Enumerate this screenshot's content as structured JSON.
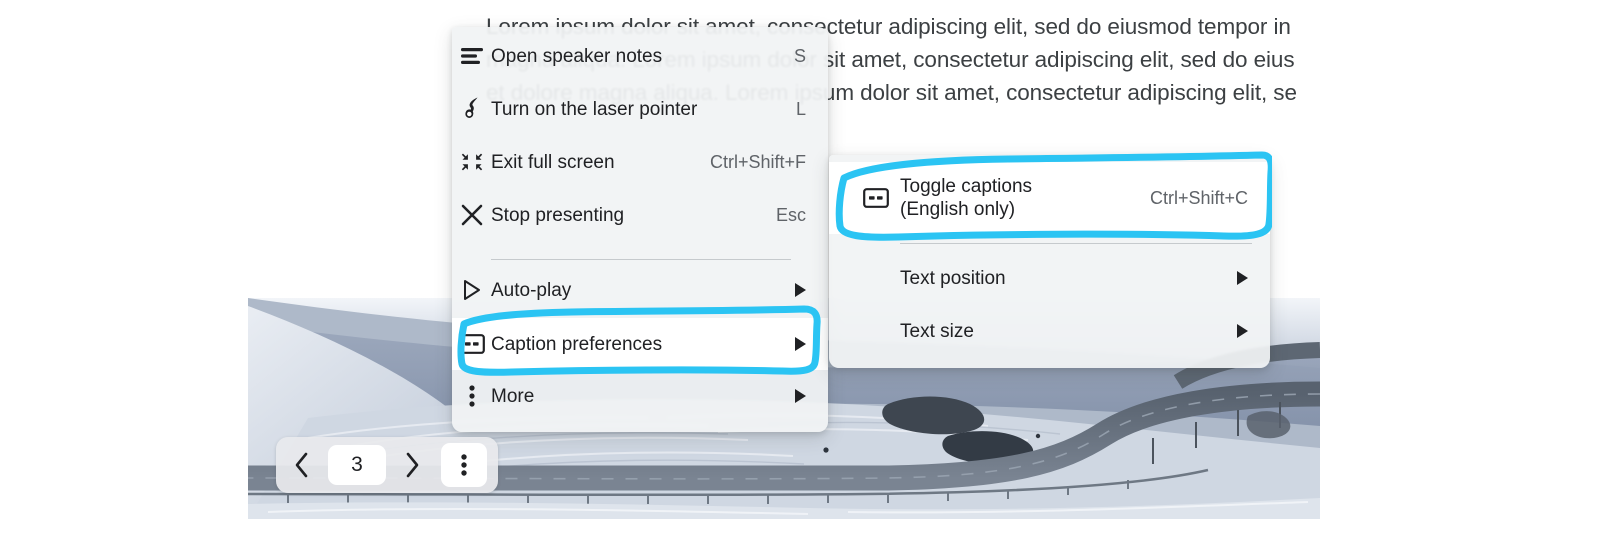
{
  "slide": {
    "lines": [
      "Lorem ipsum dolor sit amet, consectetur adipiscing elit, sed do eiusmod tempor in",
      "magna aliqua. Lorem ipsum dolor sit amet, consectetur adipiscing elit, sed do eius",
      "et dolore magna aliqua. Lorem ipsum dolor sit amet, consectetur adipiscing elit, se"
    ]
  },
  "colors": {
    "accent_cyan": "#2BC4F3",
    "menu_bg": "#F1F3F4",
    "highlight_bg": "#FFFFFF",
    "text": "#202124",
    "accel_text": "#5F6368",
    "separator": "#C6CACD"
  },
  "presenter_menu": {
    "items": [
      {
        "label": "Open speaker notes",
        "accel": "S",
        "icon": "speaker-notes-icon",
        "submenu": false,
        "highlighted": false
      },
      {
        "label": "Turn on the laser pointer",
        "accel": "L",
        "icon": "laser-pointer-icon",
        "submenu": false,
        "highlighted": false
      },
      {
        "label": "Exit full screen",
        "accel": "Ctrl+Shift+F",
        "icon": "exit-fullscreen-icon",
        "submenu": false,
        "highlighted": false
      },
      {
        "label": "Stop presenting",
        "accel": "Esc",
        "icon": "close-icon",
        "submenu": false,
        "highlighted": false
      },
      {
        "label": "Auto-play",
        "accel": "",
        "icon": "play-icon",
        "submenu": true,
        "highlighted": false
      },
      {
        "label": "Caption preferences",
        "accel": "",
        "icon": "closed-caption-icon",
        "submenu": true,
        "highlighted": true
      },
      {
        "label": "More",
        "accel": "",
        "icon": "more-vert-icon",
        "submenu": true,
        "highlighted": false
      }
    ]
  },
  "caption_submenu": {
    "items": [
      {
        "label": "Toggle captions\n(English only)",
        "accel": "Ctrl+Shift+C",
        "icon": "closed-caption-icon",
        "submenu": false,
        "highlighted": true
      },
      {
        "label": "Text position",
        "accel": "",
        "icon": "",
        "submenu": true,
        "highlighted": false
      },
      {
        "label": "Text size",
        "accel": "",
        "icon": "",
        "submenu": true,
        "highlighted": false
      }
    ]
  },
  "navbar": {
    "prev_label": "Previous slide",
    "next_label": "Next slide",
    "page_number": "3",
    "more_label": "More options"
  },
  "annotations": [
    {
      "name": "caption-preferences-highlight",
      "target": "Caption preferences",
      "color": "#2BC4F3"
    },
    {
      "name": "toggle-captions-highlight",
      "target": "Toggle captions (English only)",
      "color": "#2BC4F3"
    }
  ]
}
